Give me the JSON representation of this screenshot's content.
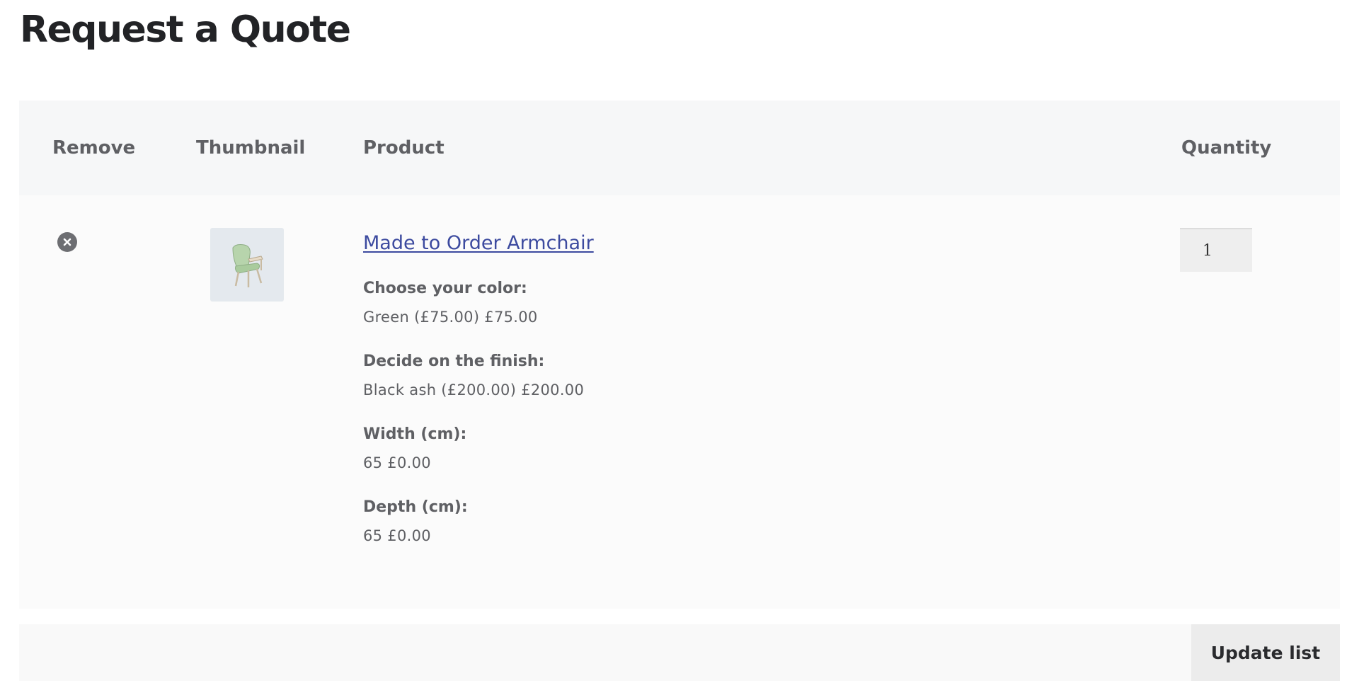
{
  "page": {
    "title": "Request a Quote"
  },
  "table": {
    "headers": {
      "remove": "Remove",
      "thumbnail": "Thumbnail",
      "product": "Product",
      "quantity": "Quantity"
    },
    "rows": [
      {
        "remove_icon": "close-circle-icon",
        "thumbnail_alt": "green armchair image",
        "product_name": "Made to Order Armchair",
        "variations": [
          {
            "label": "Choose your color:",
            "value": "Green (£75.00) £75.00"
          },
          {
            "label": "Decide on the finish:",
            "value": "Black ash (£200.00) £200.00"
          },
          {
            "label": "Width (cm):",
            "value": "65 £0.00"
          },
          {
            "label": "Depth (cm):",
            "value": "65 £0.00"
          }
        ],
        "quantity": "1"
      }
    ]
  },
  "actions": {
    "update_label": "Update list"
  },
  "colors": {
    "link": "#3c4a9f",
    "header_bg": "#f6f7f8",
    "row_bg": "#fbfbfb",
    "remove_icon": "#6d6e72"
  }
}
